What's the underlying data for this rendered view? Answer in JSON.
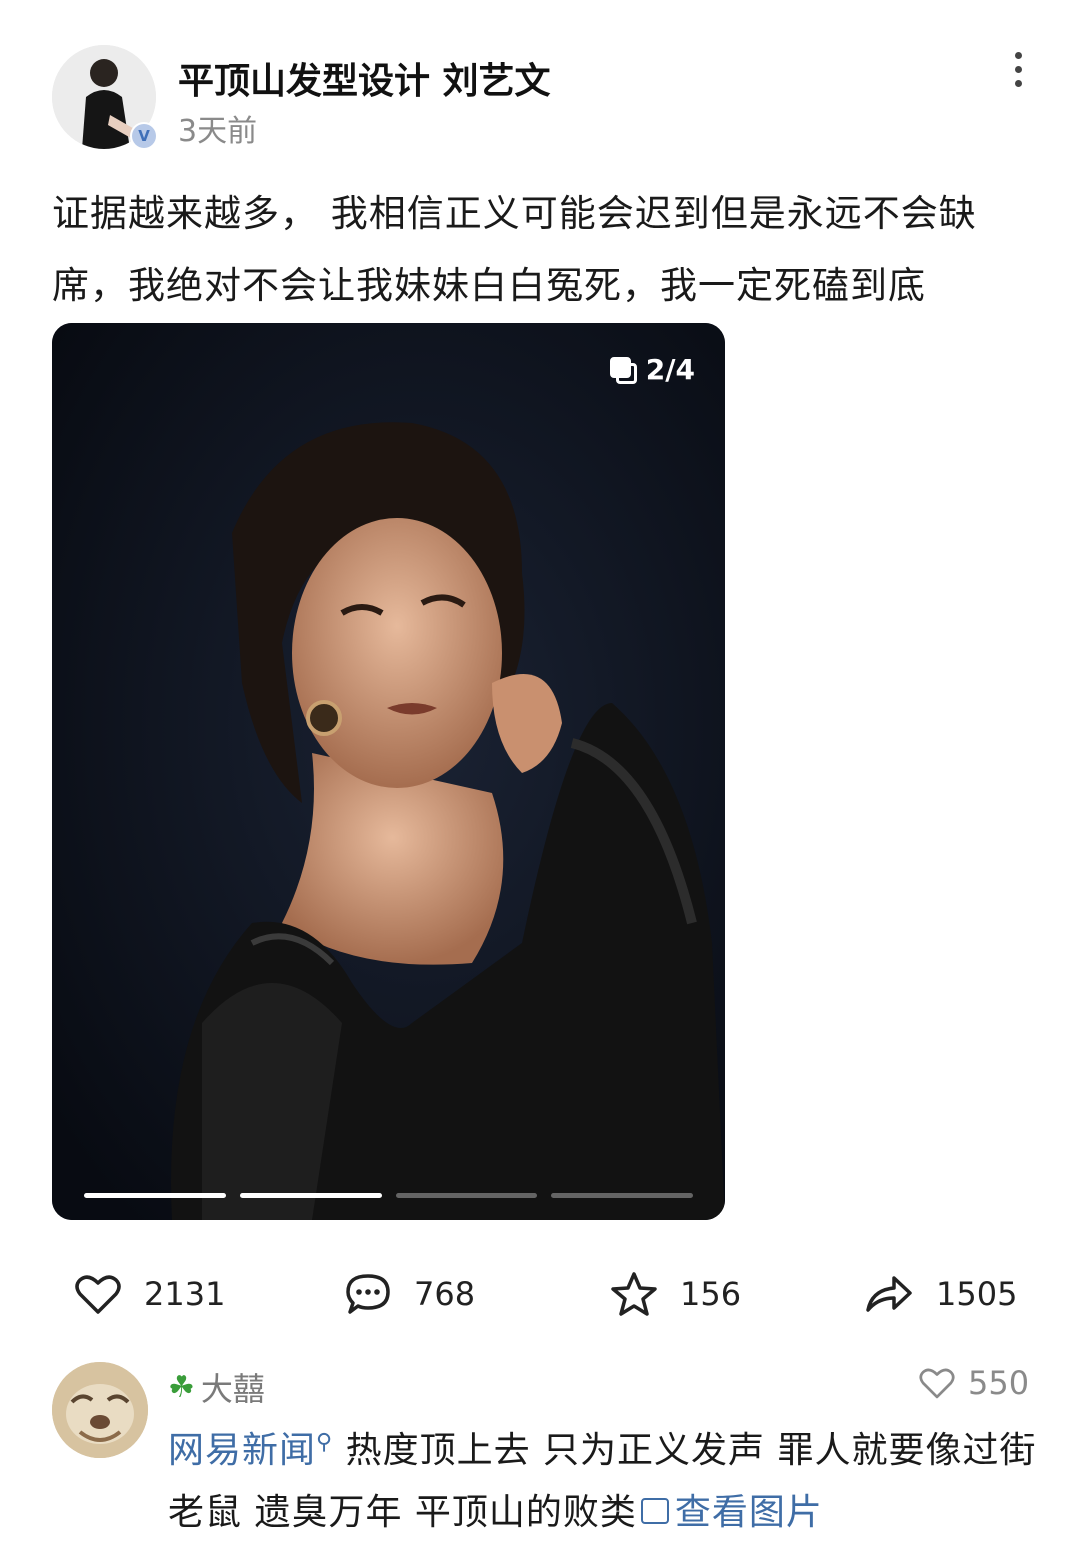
{
  "post": {
    "author": "平顶山发型设计 刘艺文",
    "time": "3天前",
    "verified_badge": "V",
    "text": "证据越来越多， 我相信正义可能会迟到但是永远不会缺席，我绝对不会让我妹妹白白冤死，我一定死磕到底",
    "image_counter": "2/4",
    "image_total": 4,
    "image_current": 2
  },
  "actions": {
    "likes": "2131",
    "comments": "768",
    "favorites": "156",
    "shares": "1505"
  },
  "comment": {
    "user_icon": "four-leaf-clover",
    "user_name": "大囍",
    "likes": "550",
    "link_text": "网易新闻",
    "body": "热度顶上去  只为正义发声  罪人就要像过街老鼠 遗臭万年  平顶山的败类",
    "image_link": "查看图片"
  },
  "colors": {
    "link": "#3f6da6",
    "photo_bg": "#0c111c",
    "secondary_text": "#8a8a8a"
  }
}
